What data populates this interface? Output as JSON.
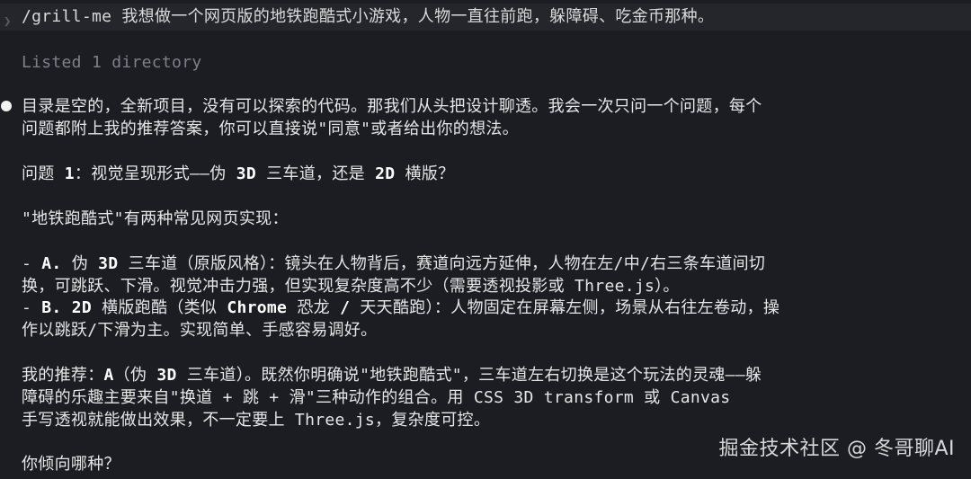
{
  "prompt": {
    "command": "/grill-me 我想做一个网页版的地铁跑酷式小游戏，人物一直往前跑，躲障碍、吃金币那种。"
  },
  "tool_output": "Listed 1 directory",
  "response": {
    "intro_1": "目录是空的，全新项目，没有可以探索的代码。那我们从头把设计聊透。我会一次只问一个问题，每个",
    "intro_2": "问题都附上我的推荐答案，你可以直接说\"同意\"或者给出你的想法。",
    "question_prefix": "问题 ",
    "question_num": "1",
    "question_mid": "：视觉呈现形式——伪 ",
    "question_3d": "3D",
    "question_mid2": " 三车道，还是 ",
    "question_2d": "2D",
    "question_suffix": " 横版？",
    "context": "\"地铁跑酷式\"有两种常见网页实现：",
    "option_a_prefix": "- ",
    "option_a_label": "A.",
    "option_a_mid": " 伪 ",
    "option_a_3d": "3D",
    "option_a_text": " 三车道（原版风格）：镜头在人物背后，赛道向远方延伸，人物在左/中/右三条车道间切",
    "option_a_line2": "换，可跳跃、下滑。视觉冲击力强，但实现复杂度高不少（需要透视投影或 Three.js）。",
    "option_b_prefix": "- ",
    "option_b_label": "B.",
    "option_b_mid": " ",
    "option_b_2d": "2D",
    "option_b_text1": " 横版跑酷（类似 ",
    "option_b_chrome": "Chrome",
    "option_b_text2": " 恐龙 ",
    "option_b_slash": "/",
    "option_b_text3": " 天天酷跑）：人物固定在屏幕左侧，场景从右往左卷动，操",
    "option_b_line2": "作以跳跃/下滑为主。实现简单、手感容易调好。",
    "rec_prefix": "我的推荐：",
    "rec_a": "A",
    "rec_mid": "（伪 ",
    "rec_3d": "3D",
    "rec_text": " 三车道）。既然你明确说\"地铁跑酷式\"，三车道左右切换是这个玩法的灵魂——躲",
    "rec_line2": "障碍的乐趣主要来自\"换道 + 跳 + 滑\"三种动作的组合。用 CSS 3D transform 或 Canvas",
    "rec_line3": "手写透视就能做出效果，不一定要上 Three.js，复杂度可控。",
    "closing": "你倾向哪种？"
  },
  "watermark": "掘金技术社区 @ 冬哥聊AI",
  "colors": {
    "background": "#1c1d22",
    "text": "#e6e6e6",
    "muted": "#7d8088"
  }
}
